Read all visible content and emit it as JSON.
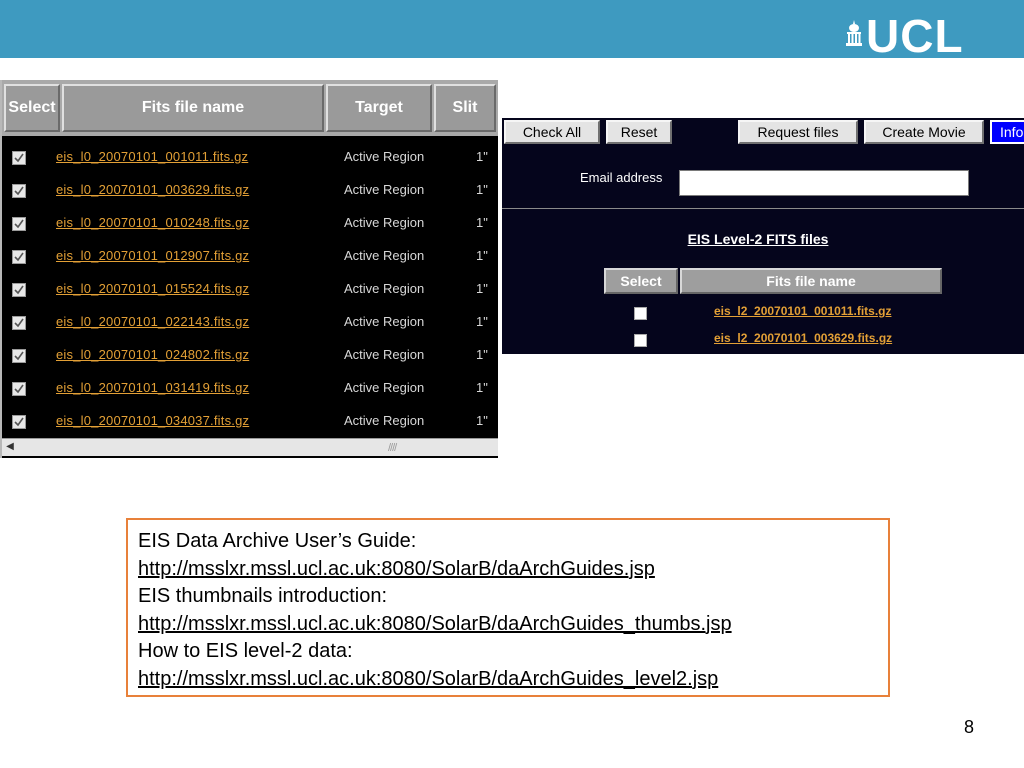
{
  "header": {
    "logo_text": "UCL",
    "brand_color": "#3e9ac0"
  },
  "level0_table": {
    "columns": [
      "Select",
      "Fits file name",
      "Target",
      "Slit"
    ],
    "rows": [
      {
        "checked": true,
        "file": "eis_l0_20070101_001011.fits.gz",
        "target": "Active Region",
        "slit": "1\""
      },
      {
        "checked": true,
        "file": "eis_l0_20070101_003629.fits.gz",
        "target": "Active Region",
        "slit": "1\""
      },
      {
        "checked": true,
        "file": "eis_l0_20070101_010248.fits.gz",
        "target": "Active Region",
        "slit": "1\""
      },
      {
        "checked": true,
        "file": "eis_l0_20070101_012907.fits.gz",
        "target": "Active Region",
        "slit": "1\""
      },
      {
        "checked": true,
        "file": "eis_l0_20070101_015524.fits.gz",
        "target": "Active Region",
        "slit": "1\""
      },
      {
        "checked": true,
        "file": "eis_l0_20070101_022143.fits.gz",
        "target": "Active Region",
        "slit": "1\""
      },
      {
        "checked": true,
        "file": "eis_l0_20070101_024802.fits.gz",
        "target": "Active Region",
        "slit": "1\""
      },
      {
        "checked": true,
        "file": "eis_l0_20070101_031419.fits.gz",
        "target": "Active Region",
        "slit": "1\""
      },
      {
        "checked": true,
        "file": "eis_l0_20070101_034037.fits.gz",
        "target": "Active Region",
        "slit": "1\""
      }
    ]
  },
  "request_panel": {
    "buttons": {
      "check_all": "Check  All",
      "reset": "Reset",
      "request_files": "Request  files",
      "create_movie": "Create  Movie",
      "info": "Info"
    },
    "email_label": "Email address",
    "email_value": "",
    "level2_heading": "EIS Level-2 FITS files",
    "level2_columns": [
      "Select",
      "Fits file name"
    ],
    "level2_rows": [
      {
        "checked": false,
        "file": "eis_l2_20070101_001011.fits.gz"
      },
      {
        "checked": false,
        "file": "eis_l2_20070101_003629.fits.gz"
      }
    ]
  },
  "guides": {
    "lines": [
      {
        "label": "EIS Data Archive User’s Guide:",
        "url": "http://msslxr.mssl.ucl.ac.uk:8080/SolarB/daArchGuides.jsp"
      },
      {
        "label": "EIS thumbnails introduction:",
        "url": "http://msslxr.mssl.ucl.ac.uk:8080/SolarB/daArchGuides_thumbs.jsp"
      },
      {
        "label": "How to EIS level-2 data:",
        "url": "http://msslxr.mssl.ucl.ac.uk:8080/SolarB/daArchGuides_level2.jsp"
      }
    ],
    "border_color": "#e8813a"
  },
  "page_number": "8",
  "colors": {
    "link_orange": "#e3a036",
    "info_blue": "#0000ff",
    "panel_dark": "#05051c"
  }
}
